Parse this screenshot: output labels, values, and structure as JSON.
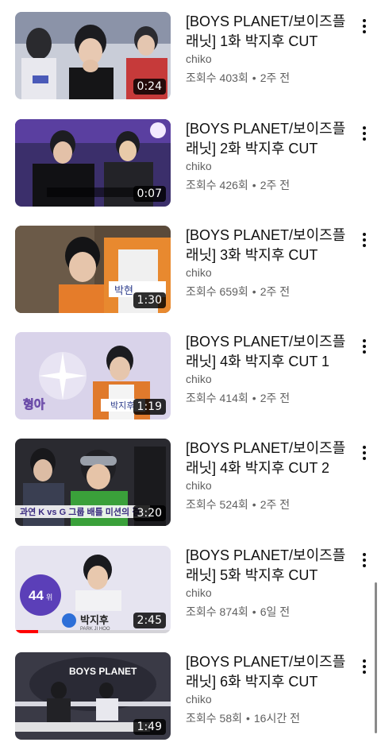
{
  "videos": [
    {
      "title": "[BOYS PLANET/보이즈플래닛] 1화 박지후 CUT",
      "channel": "chiko",
      "views": "조회수 403회",
      "age": "2주 전",
      "duration": "0:24",
      "progress": 0
    },
    {
      "title": "[BOYS PLANET/보이즈플래닛] 2화 박지후 CUT",
      "channel": "chiko",
      "views": "조회수 426회",
      "age": "2주 전",
      "duration": "0:07",
      "progress": 0
    },
    {
      "title": "[BOYS PLANET/보이즈플래닛] 3화 박지후 CUT",
      "channel": "chiko",
      "views": "조회수 659회",
      "age": "2주 전",
      "duration": "1:30",
      "progress": 0
    },
    {
      "title": "[BOYS PLANET/보이즈플래닛] 4화 박지후 CUT 1",
      "channel": "chiko",
      "views": "조회수 414회",
      "age": "2주 전",
      "duration": "1:19",
      "progress": 0
    },
    {
      "title": "[BOYS PLANET/보이즈플래닛] 4화 박지후 CUT 2",
      "channel": "chiko",
      "views": "조회수 524회",
      "age": "2주 전",
      "duration": "3:20",
      "progress": 0
    },
    {
      "title": "[BOYS PLANET/보이즈플래닛] 5화 박지후 CUT",
      "channel": "chiko",
      "views": "조회수 874회",
      "age": "6일 전",
      "duration": "2:45",
      "progress": 0.15
    },
    {
      "title": "[BOYS PLANET/보이즈플래닛] 6화 박지후 CUT",
      "channel": "chiko",
      "views": "조회수 58회",
      "age": "16시간 전",
      "duration": "1:49",
      "progress": 0
    }
  ],
  "thumb_text": {
    "t3_name": "박현",
    "t4_caption": "형아",
    "t4_name": "박지후",
    "t5_caption": "과연 K vs G 그룹 배틀 미션의 결",
    "t6_rank": "44",
    "t6_rank_unit": "위",
    "t6_name": "박지후",
    "t6_sub": "PARK JI HOO",
    "t7_logo": "BOYS PLANET"
  },
  "separator": "•",
  "colors": {
    "text": "#0f0f0f",
    "secondary": "#606060",
    "progress": "#ff0000"
  }
}
